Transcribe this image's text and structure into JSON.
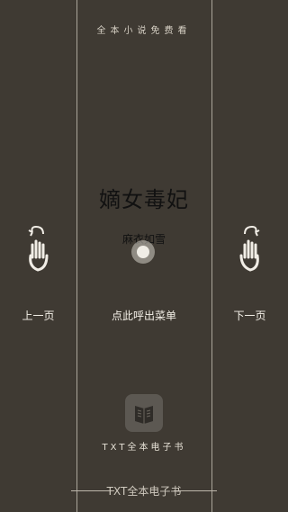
{
  "header": {
    "app_title": "全本小说免费看"
  },
  "book": {
    "title": "嫡女毒妃",
    "author": "麻衣如雪"
  },
  "nav": {
    "prev_label": "上一页",
    "menu_label": "点此呼出菜单",
    "next_label": "下一页"
  },
  "brand": {
    "caption": "TXT全本电子书"
  },
  "footer": {
    "text": "TXT全本电子书"
  },
  "icons": {
    "prev": "hand-swipe-left-icon",
    "next": "hand-swipe-right-icon",
    "tap": "tap-indicator-icon",
    "logo": "book-logo-icon"
  },
  "colors": {
    "background": "#3f3a33",
    "divider": "#cfc9bd",
    "title_text": "#111111"
  }
}
